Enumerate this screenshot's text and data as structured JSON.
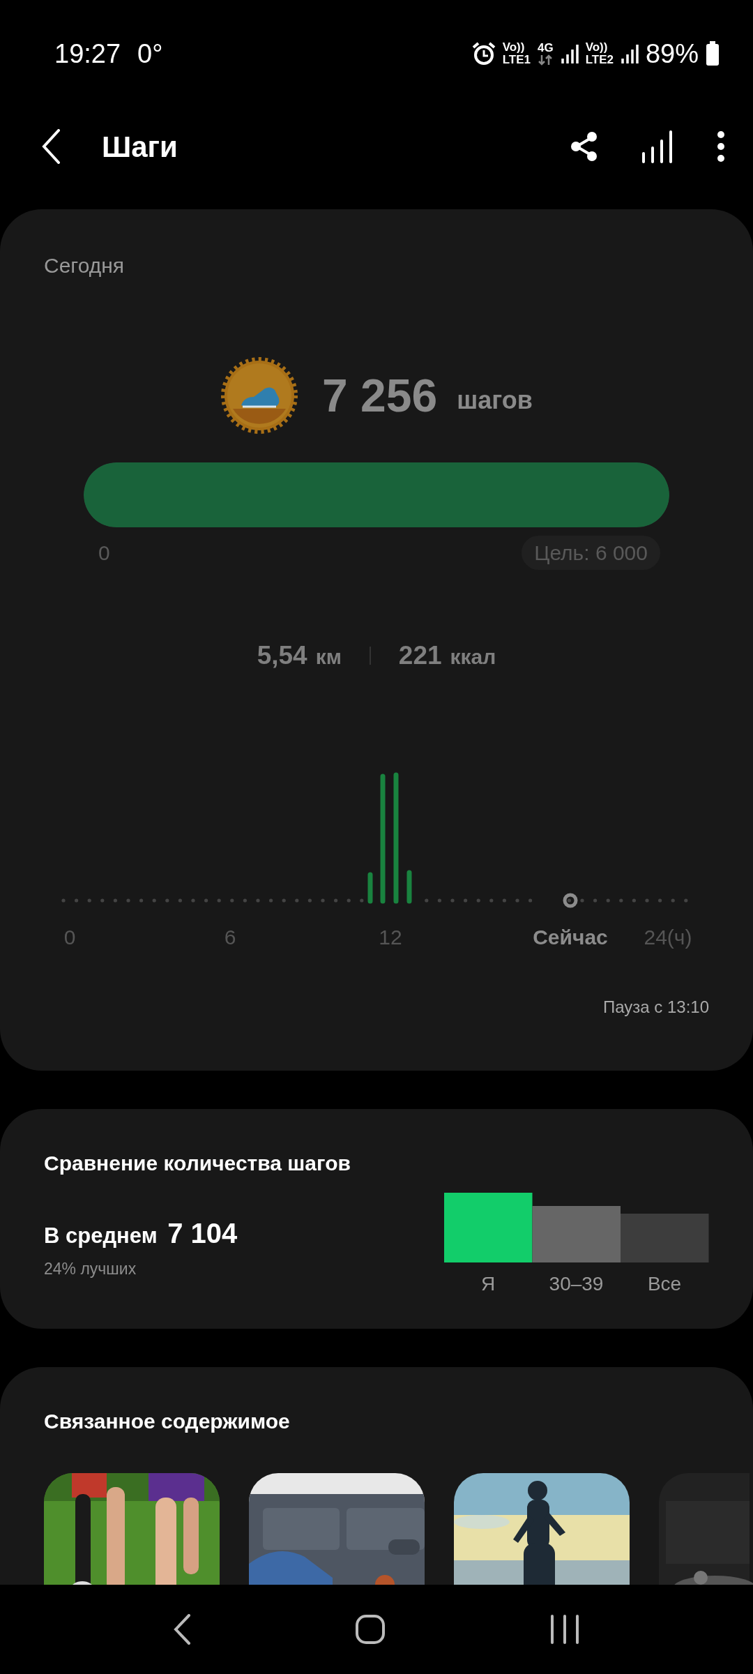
{
  "status_bar": {
    "time": "19:27",
    "temperature": "0°",
    "network": [
      {
        "top": "Vo))",
        "bottom": "LTE1"
      },
      {
        "top": "4G"
      },
      {
        "top": "Vo))",
        "bottom": "LTE2"
      }
    ],
    "battery": "89%"
  },
  "header": {
    "title": "Шаги"
  },
  "today": {
    "label": "Сегодня",
    "steps": "7 256",
    "steps_unit": "шагов",
    "progress": {
      "level": 1,
      "start": "0",
      "goal": "Цель: 6 000"
    },
    "stats": [
      {
        "value": "5,54",
        "unit": "км"
      },
      {
        "value": "221",
        "unit": "ккал"
      }
    ],
    "timeline": {
      "labels": [
        {
          "text": "0",
          "kind": "tick"
        },
        {
          "text": "6",
          "kind": "tick"
        },
        {
          "text": "12",
          "kind": "tick"
        },
        {
          "text": "Сейчас",
          "kind": "now"
        },
        {
          "text": "24(ч)",
          "kind": "tick"
        }
      ]
    },
    "pause": "Пауза с 13:10"
  },
  "comparison": {
    "title": "Сравнение количества шагов",
    "average_label": "В среднем",
    "average_value": "7 104",
    "rank": "24% лучших",
    "groups": [
      {
        "label": "Я",
        "color": "#12cd6a"
      },
      {
        "label": "30–39",
        "color": "#666666"
      },
      {
        "label": "Все",
        "color": "#3d3d3d"
      }
    ]
  },
  "related": {
    "title": "Связанное содержимое"
  }
}
